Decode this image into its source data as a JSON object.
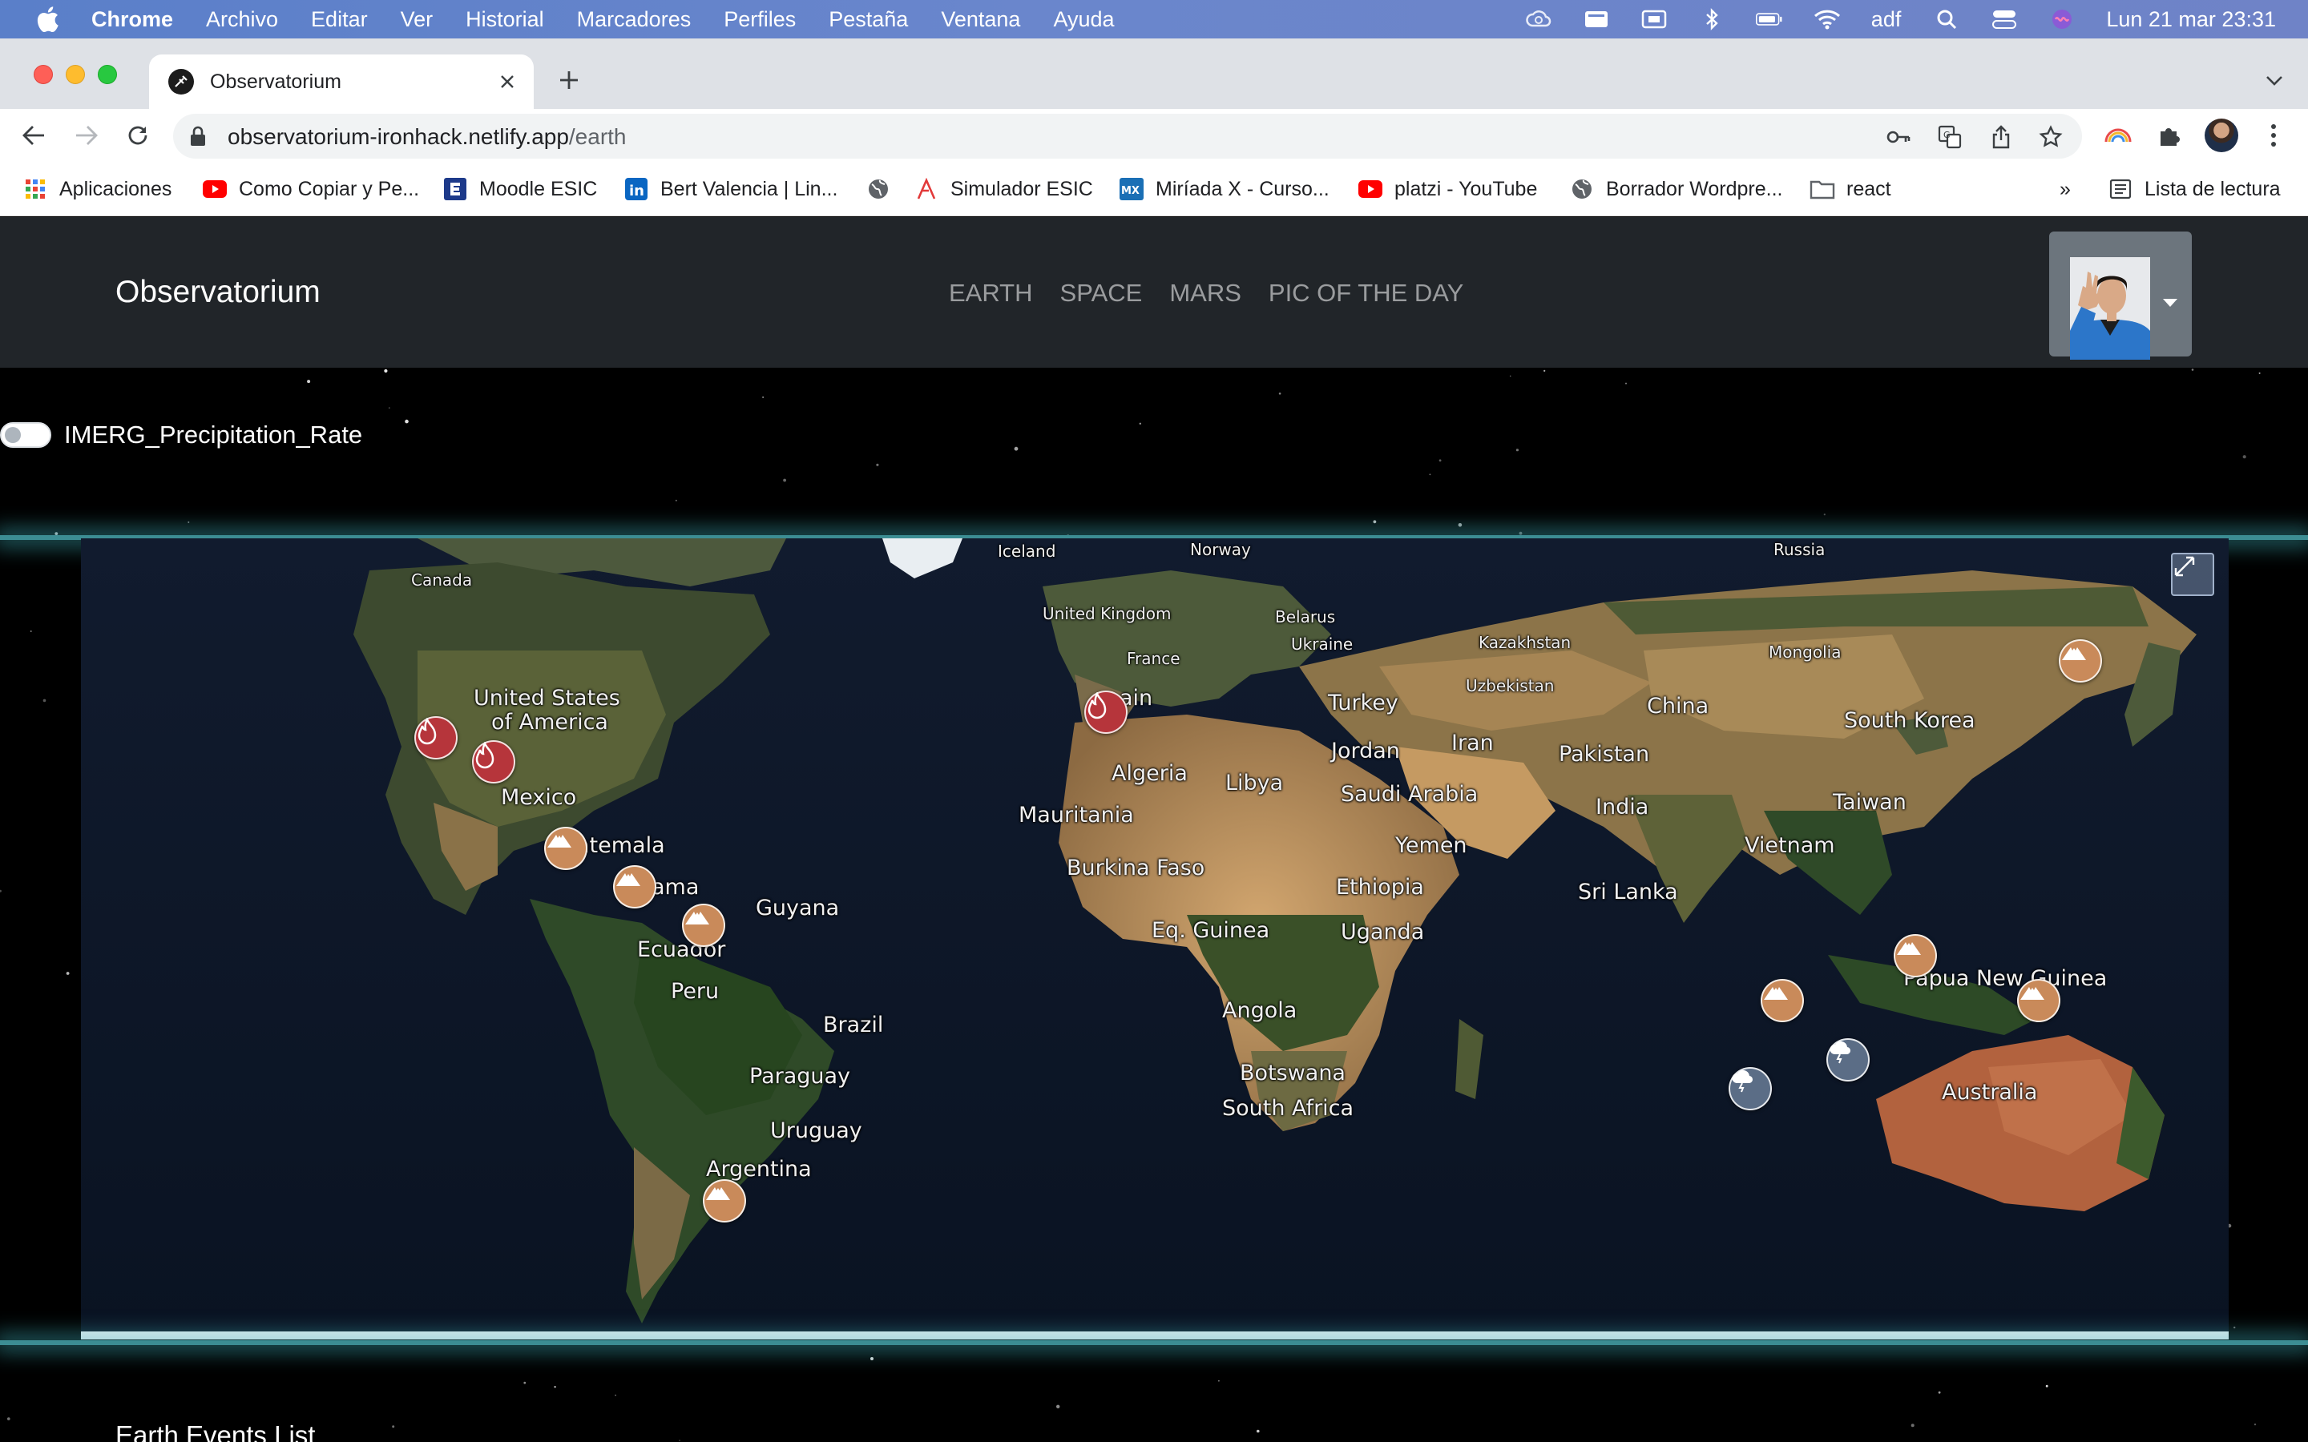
{
  "menubar": {
    "app": "Chrome",
    "items": [
      "Archivo",
      "Editar",
      "Ver",
      "Historial",
      "Marcadores",
      "Perfiles",
      "Pestaña",
      "Ventana",
      "Ayuda"
    ],
    "user": "adf",
    "clock": "Lun 21 mar  23:31"
  },
  "tab": {
    "title": "Observatorium"
  },
  "address": {
    "host": "observatorium-ironhack.netlify.app",
    "path": "/earth"
  },
  "bookmarks": {
    "apps": "Aplicaciones",
    "items": [
      "Como Copiar y Pe...",
      "Moodle ESIC",
      "Bert Valencia | Lin...",
      "Simulador ESIC",
      "Miríada X - Curso...",
      "platzi - YouTube",
      "Borrador Wordpre...",
      "react"
    ],
    "more": "»",
    "reading_list": "Lista de lectura"
  },
  "site": {
    "brand": "Observatorium",
    "nav": [
      "EARTH",
      "SPACE",
      "MARS",
      "PIC OF THE DAY"
    ]
  },
  "layer_toggle": {
    "label": "IMERG_Precipitation_Rate",
    "on": false
  },
  "map": {
    "labels": [
      "Iceland",
      "Norway",
      "Russia",
      "Canada",
      "United Kingdom",
      "Belarus",
      "Ukraine",
      "Kazakhstan",
      "Mongolia",
      "France",
      "Uzbekistan",
      "United States",
      "of America",
      "ain",
      "Turkey",
      "China",
      "South Korea",
      "Iran",
      "Jordan",
      "Pakistan",
      "Algeria",
      "Libya",
      "Mexico",
      "Saudi Arabia",
      "India",
      "Taiwan",
      "Mauritania",
      "atemala",
      "Yemen",
      "Vietnam",
      "Burkina Faso",
      "Ethiopia",
      "ama",
      "Guyana",
      "Sri Lanka",
      "Eq. Guinea",
      "Uganda",
      "Ecuador",
      "Papua New Guinea",
      "Peru",
      "Brazil",
      "Angola",
      "Australia",
      "Paraguay",
      "Botswana",
      "South Africa",
      "Uruguay",
      "Argentina"
    ],
    "event_types": [
      "wildfire-icon",
      "volcano-icon",
      "severe-storm-icon"
    ]
  },
  "events": {
    "heading": "Earth Events List"
  }
}
